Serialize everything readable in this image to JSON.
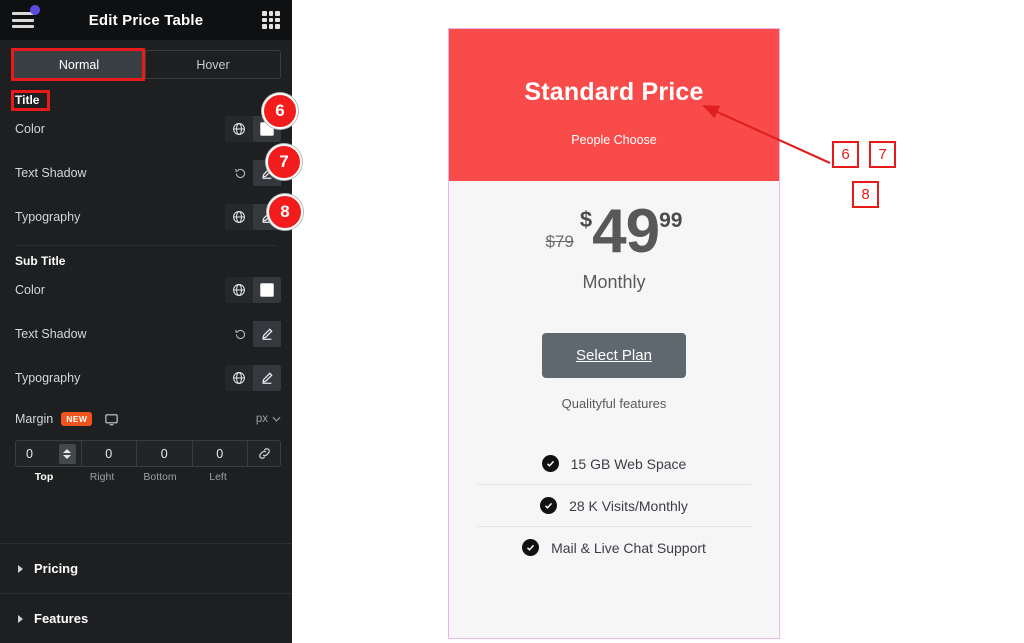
{
  "panel": {
    "title": "Edit Price Table",
    "menu_icon": "hamburger-icon",
    "grid_icon": "grid-apps-icon",
    "tabs": [
      {
        "label": "Normal",
        "active": true
      },
      {
        "label": "Hover",
        "active": false
      }
    ],
    "sections": [
      {
        "label": "Title",
        "controls": [
          {
            "label": "Color",
            "type": "color",
            "globe": true,
            "swatch": "#ffffff"
          },
          {
            "label": "Text Shadow",
            "type": "edit",
            "reset": true
          },
          {
            "label": "Typography",
            "type": "edit",
            "globe": true
          }
        ]
      },
      {
        "label": "Sub Title",
        "controls": [
          {
            "label": "Color",
            "type": "color",
            "globe": true,
            "swatch": "#ffffff"
          },
          {
            "label": "Text Shadow",
            "type": "edit",
            "reset": true
          },
          {
            "label": "Typography",
            "type": "edit",
            "globe": true
          }
        ]
      }
    ],
    "margin": {
      "label": "Margin",
      "badge": "NEW",
      "device_icon": "desktop-icon",
      "unit": "px",
      "values": {
        "top": "0",
        "right": "0",
        "bottom": "0",
        "left": "0"
      },
      "labels": {
        "top": "Top",
        "right": "Right",
        "bottom": "Bottom",
        "left": "Left"
      },
      "link_icon": "link-icon"
    },
    "accordions": [
      {
        "label": "Pricing"
      },
      {
        "label": "Features"
      }
    ],
    "collapse_icon": "chevron-left-icon"
  },
  "card": {
    "title": "Standard Price",
    "subtitle": "People Choose",
    "old_price": "$79",
    "currency": "$",
    "amount": "49",
    "cents": "99",
    "period": "Monthly",
    "button_label": "Select Plan",
    "foot_note": "Qualityful features",
    "features": [
      "15 GB Web Space",
      "28 K Visits/Monthly",
      "Mail & Live Chat Support"
    ],
    "banner_color": "#fa4b4b",
    "border_color": "#eab6e8"
  },
  "annotations": {
    "circles": [
      {
        "number": "6"
      },
      {
        "number": "7"
      },
      {
        "number": "8"
      }
    ],
    "boxes": [
      {
        "number": "6"
      },
      {
        "number": "7"
      },
      {
        "number": "8"
      }
    ],
    "highlight_color": "#e81a1a"
  }
}
